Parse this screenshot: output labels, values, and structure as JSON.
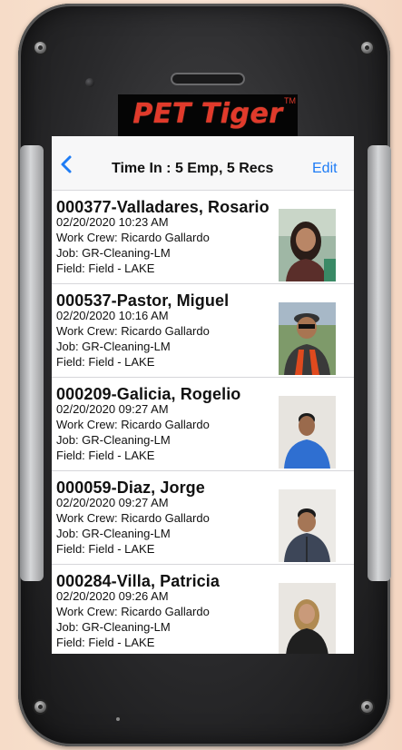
{
  "app": {
    "brand": "PET Tiger",
    "trademark": "TM"
  },
  "navbar": {
    "back_icon": "chevron-left-icon",
    "title": "Time In :  5 Emp, 5 Recs",
    "edit_label": "Edit"
  },
  "records": [
    {
      "name": "000377-Valladares, Rosario",
      "datetime": "02/20/2020  10:23 AM",
      "work_crew": "Work Crew: Ricardo Gallardo",
      "job": "Job: GR-Cleaning-LM",
      "field": "Field: Field - LAKE"
    },
    {
      "name": "000537-Pastor, Miguel",
      "datetime": "02/20/2020  10:16 AM",
      "work_crew": "Work Crew: Ricardo Gallardo",
      "job": "Job: GR-Cleaning-LM",
      "field": "Field: Field - LAKE"
    },
    {
      "name": "000209-Galicia, Rogelio",
      "datetime": "02/20/2020  09:27 AM",
      "work_crew": "Work Crew: Ricardo Gallardo",
      "job": "Job: GR-Cleaning-LM",
      "field": "Field: Field - LAKE"
    },
    {
      "name": "000059-Diaz, Jorge",
      "datetime": "02/20/2020  09:27 AM",
      "work_crew": "Work Crew: Ricardo Gallardo",
      "job": "Job: GR-Cleaning-LM",
      "field": "Field: Field - LAKE"
    },
    {
      "name": "000284-Villa, Patricia",
      "datetime": "02/20/2020  09:26 AM",
      "work_crew": "Work Crew: Ricardo Gallardo",
      "job": "Job: GR-Cleaning-LM",
      "field": "Field: Field - LAKE"
    }
  ],
  "colors": {
    "accent": "#1e7cf5",
    "brand": "#e13a2b"
  }
}
